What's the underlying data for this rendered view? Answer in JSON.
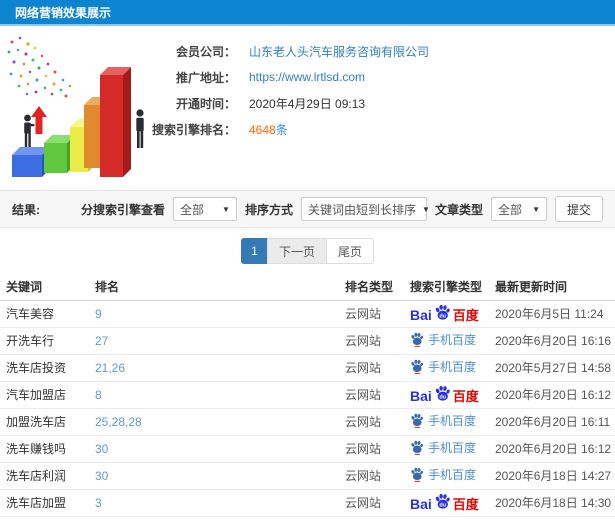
{
  "header": {
    "title": "网络营销效果展示"
  },
  "info": {
    "rows": [
      {
        "label": "会员公司：",
        "value": "山东老人头汽车服务咨询有限公司"
      },
      {
        "label": "推广地址：",
        "value": "https://www.lrtlsd.com"
      },
      {
        "label": "开通时间：",
        "value": "2020年4月29日 09:13"
      },
      {
        "label": "搜索引擎排名：",
        "value": "4648",
        "unit": "条"
      }
    ]
  },
  "filters": {
    "section_label": "结果:",
    "engine_label": "分搜索引擎查看",
    "engine_value": "全部",
    "sort_label": "排序方式",
    "sort_value": "关键词由短到长排序",
    "article_label": "文章类型",
    "article_value": "全部",
    "submit_label": "提交"
  },
  "pagination": {
    "current": "1",
    "next_label": "下一页",
    "last_label": "尾页"
  },
  "table": {
    "headers": [
      "关键词",
      "排名",
      "排名类型",
      "搜索引擎类型",
      "最新更新时间"
    ],
    "rows": [
      {
        "keyword": "汽车美容",
        "rank": "9",
        "rank_type": "云网站",
        "engine": "baidu",
        "updated": "2020年6月5日 11:24"
      },
      {
        "keyword": "开洗车行",
        "rank": "27",
        "rank_type": "云网站",
        "engine": "mobile-baidu",
        "updated": "2020年6月20日 16:16"
      },
      {
        "keyword": "洗车店投资",
        "rank": "21,26",
        "rank_type": "云网站",
        "engine": "mobile-baidu",
        "updated": "2020年5月27日 14:58"
      },
      {
        "keyword": "汽车加盟店",
        "rank": "8",
        "rank_type": "云网站",
        "engine": "baidu",
        "updated": "2020年6月20日 16:12"
      },
      {
        "keyword": "加盟洗车店",
        "rank": "25,28,28",
        "rank_type": "云网站",
        "engine": "mobile-baidu",
        "updated": "2020年6月20日 16:11"
      },
      {
        "keyword": "洗车赚钱吗",
        "rank": "30",
        "rank_type": "云网站",
        "engine": "mobile-baidu",
        "updated": "2020年6月20日 16:12"
      },
      {
        "keyword": "洗车店利润",
        "rank": "30",
        "rank_type": "云网站",
        "engine": "mobile-baidu",
        "updated": "2020年6月18日 14:27"
      },
      {
        "keyword": "洗车店加盟",
        "rank": "3",
        "rank_type": "云网站",
        "engine": "baidu",
        "updated": "2020年6月18日 14:30"
      }
    ]
  },
  "engine_labels": {
    "baidu_prefix": "Bai",
    "baidu_du": "du",
    "baidu_suffix": "百度",
    "mobile_label": "手机百度"
  },
  "colors": {
    "header_bg": "#0d84cf",
    "link_blue": "#2e82c4",
    "rank_blue": "#5b9bd5",
    "highlight_orange": "#ff6600",
    "highlight_unit_blue": "#3a8ee6",
    "pagination_active": "#337ab7",
    "baidu_blue": "#2932e1",
    "baidu_red": "#e10601",
    "mobile_engine_blue": "#4a90d2"
  }
}
